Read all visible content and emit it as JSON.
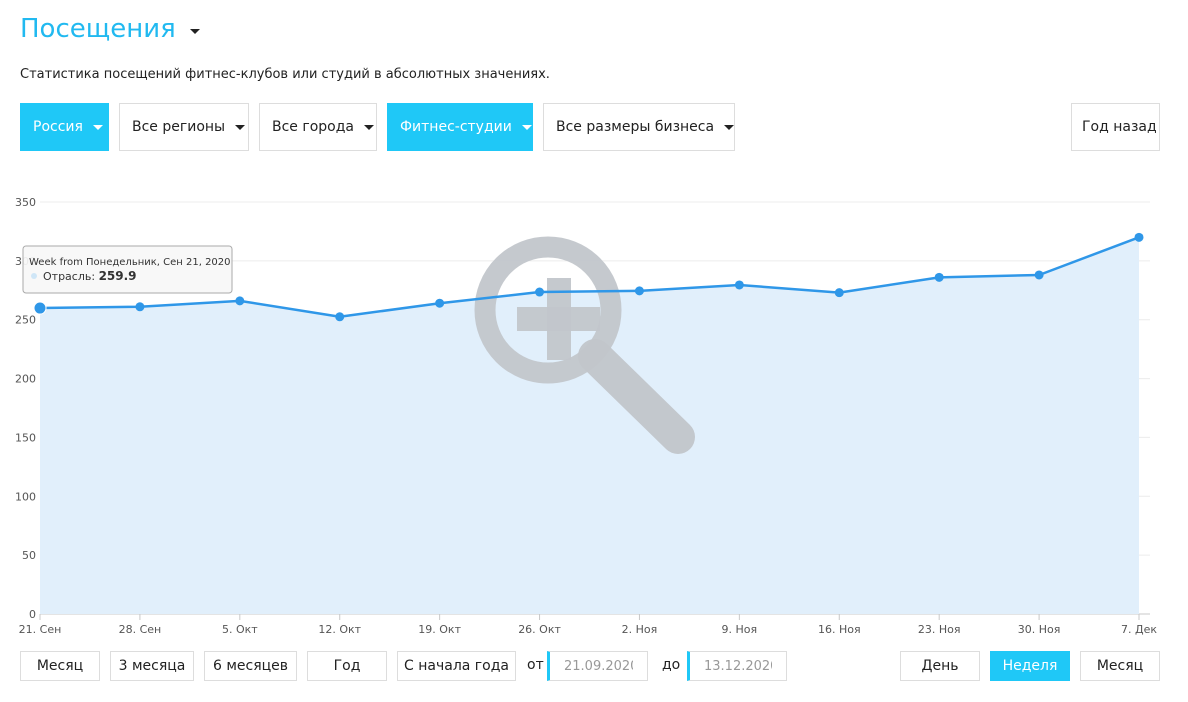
{
  "header": {
    "title": "Посещения",
    "subtitle": "Статистика посещений фитнес-клубов или студий в абсолютных значениях."
  },
  "filters": {
    "country": "Россия",
    "region": "Все регионы",
    "city": "Все города",
    "business_type": "Фитнес-студии",
    "business_size": "Все размеры бизнеса",
    "compare": "Год назад"
  },
  "ranges": {
    "month": "Месяц",
    "three_months": "3 месяца",
    "six_months": "6 месяцев",
    "year": "Год",
    "ytd": "С начала года",
    "from_label": "от",
    "to_label": "до",
    "from_placeholder": "21.09.2020",
    "to_placeholder": "13.12.2020"
  },
  "granularity": {
    "day": "День",
    "week": "Неделя",
    "month": "Месяц",
    "active": "week"
  },
  "tooltip": {
    "header": "Week from Понедельник, Сен 21, 2020",
    "series_label": "Отрасль:",
    "value": "259.9"
  },
  "colors": {
    "accent": "#1fc8f7",
    "title": "#21b9f0",
    "line": "#2f97e8",
    "area": "#e1effb"
  },
  "chart_data": {
    "type": "area",
    "categories": [
      "21. Сен",
      "28. Сен",
      "5. Окт",
      "12. Окт",
      "19. Окт",
      "26. Окт",
      "2. Ноя",
      "9. Ноя",
      "16. Ноя",
      "23. Ноя",
      "30. Ноя",
      "7. Дек"
    ],
    "series": [
      {
        "name": "Отрасль",
        "values": [
          259.9,
          261.0,
          266.0,
          252.5,
          264.0,
          273.5,
          274.5,
          279.5,
          273.0,
          286.0,
          288.0,
          320.0
        ]
      }
    ],
    "yticks": [
      0,
      50,
      100,
      150,
      200,
      250,
      300,
      350
    ],
    "ylim": [
      0,
      350
    ],
    "grid": true,
    "legend": "none",
    "zoom_icon": "zoom-in-magnifier-icon"
  }
}
